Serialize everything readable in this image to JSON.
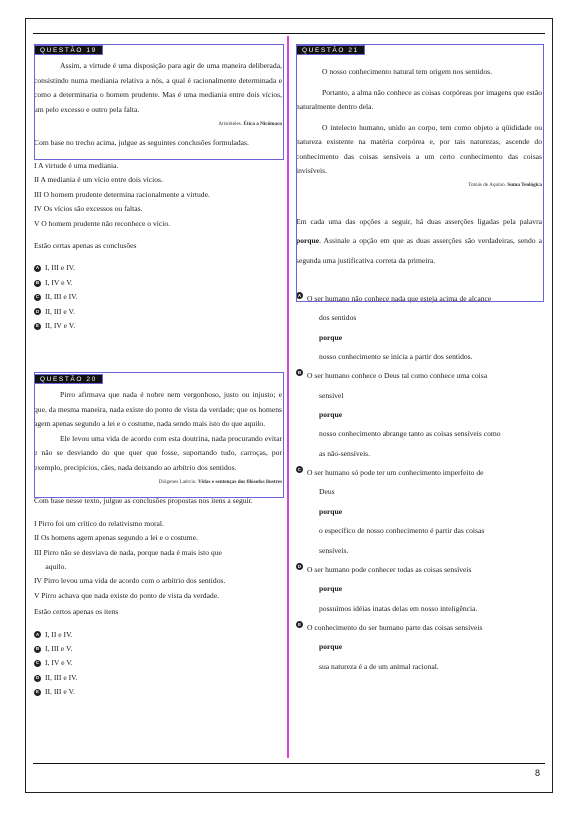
{
  "page_number": "8",
  "q19": {
    "header": "QUESTÃO 19",
    "paragraph": "Assim, a virtude é uma disposição para agir de uma maneira deliberada, consistindo numa mediania relativa a nós, a qual é racionalmente determinada e como a determinaria o homem prudente. Mas é uma mediania entre dois vícios, um pelo excesso e outro pela falta.",
    "source_author": "Aristóteles.",
    "source_title": "Ética a Nicômaco",
    "prompt": "Com base no trecho acima, julgue as seguintes conclusões formuladas.",
    "items": [
      "I   A virtude é uma mediania.",
      "II  A mediania é um vício entre dois vícios.",
      "III O homem prudente determina racionalmente a virtude.",
      "IV Os vícios são excessos ou faltas.",
      "V   O homem prudente não reconhece o vício."
    ],
    "question": "Estão certas apenas as conclusões",
    "alternatives": [
      {
        "letter": "A",
        "text": "I, III e IV."
      },
      {
        "letter": "B",
        "text": "I, IV e V."
      },
      {
        "letter": "C",
        "text": "II, III e IV."
      },
      {
        "letter": "D",
        "text": "II, III e V."
      },
      {
        "letter": "E",
        "text": "II, IV e V."
      }
    ]
  },
  "q20": {
    "header": "QUESTÃO 20",
    "paragraph": "Pirro afirmava que nada é nobre nem vergonhoso, justo ou injusto; e que, da mesma maneira, nada existe do ponto de vista da verdade; que os homens agem apenas segundo a lei e o costume, nada sendo mais isto do que aquilo.",
    "paragraph2": "Ele levou uma vida de acordo com esta doutrina, nada procurando evitar e não se desviando do que quer que fosse, suportando tudo, carroças, por exemplo, precipícios, cães, nada deixando ao arbítrio dos sentidos.",
    "source_author": "Diógenes Laércio.",
    "source_title": "Vidas e sentenças dos filósofos ilustres",
    "prompt": "Com base nesse texto, julgue as conclusões propostas nos itens a seguir.",
    "items": [
      "I   Pirro foi um crítico do relativismo moral.",
      "II  Os homens agem apenas segundo a lei e o costume.",
      "III Pirro não se desviava de nada, porque nada é mais isto que",
      "      aquilo.",
      "IV Pirro levou uma vida de acordo com o arbítrio dos sentidos.",
      "V   Pirro achava que nada existe do ponto de vista da verdade."
    ],
    "question": "Estão certos apenas os itens",
    "alternatives": [
      {
        "letter": "A",
        "text": "I, II e IV."
      },
      {
        "letter": "B",
        "text": "I, III e V."
      },
      {
        "letter": "C",
        "text": "I, IV e V."
      },
      {
        "letter": "D",
        "text": "II, III e IV."
      },
      {
        "letter": "E",
        "text": "II, III e V."
      }
    ]
  },
  "q21": {
    "header": "QUESTÃO 21",
    "p1": "O nosso conhecimento natural tem origem nos sentidos.",
    "p2": "Portanto, a alma não conhece as coisas corpóreas por imagens que estão naturalmente dentro dela.",
    "p3": "O intelecto humano, unido ao corpo, tem como objeto a qüididade ou natureza existente na matéria corpórea e, por tais naturezas, ascende do conhecimento das coisas sensíveis a um certo conhecimento das coisas invisíveis.",
    "source_author": "Tomás de Aquino.",
    "source_title": "Suma Teológica",
    "instruction_a": "Em cada uma das opções a seguir, há duas asserções ligadas pela palavra ",
    "instruction_bold": "porque",
    "instruction_b": ". Assinale a opção em que as duas asserções são verdadeiras, sendo a segunda uma justificativa correta da primeira.",
    "alternatives": [
      {
        "letter": "A",
        "first": "O ser humano não conhece nada que esteja acima de alcance",
        "first_cont": "dos sentidos",
        "connector": "porque",
        "second": "nosso conhecimento se inicia a partir dos sentidos.",
        "second_cont": ""
      },
      {
        "letter": "B",
        "first": "O ser humano conhece o Deus tal como conhece uma coisa",
        "first_cont": "sensível",
        "connector": "porque",
        "second": "nosso conhecimento abrange tanto as coisas sensíveis como",
        "second_cont": "as não-sensíveis."
      },
      {
        "letter": "C",
        "first": "O ser humano só pode ter um conhecimento imperfeito de",
        "first_cont": "Deus",
        "connector": "porque",
        "second": "o específico de nosso conhecimento é partir das coisas",
        "second_cont": "sensíveis."
      },
      {
        "letter": "D",
        "first": "O ser humano pode conhecer todas as coisas sensíveis",
        "first_cont": "",
        "connector": "porque",
        "second": "possuímos idéias inatas delas em nosso inteligência.",
        "second_cont": ""
      },
      {
        "letter": "E",
        "first": "O conhecimento do ser humano parte das coisas sensíveis",
        "first_cont": "",
        "connector": "porque",
        "second": "sua natureza é a de um animal racional.",
        "second_cont": ""
      }
    ]
  }
}
